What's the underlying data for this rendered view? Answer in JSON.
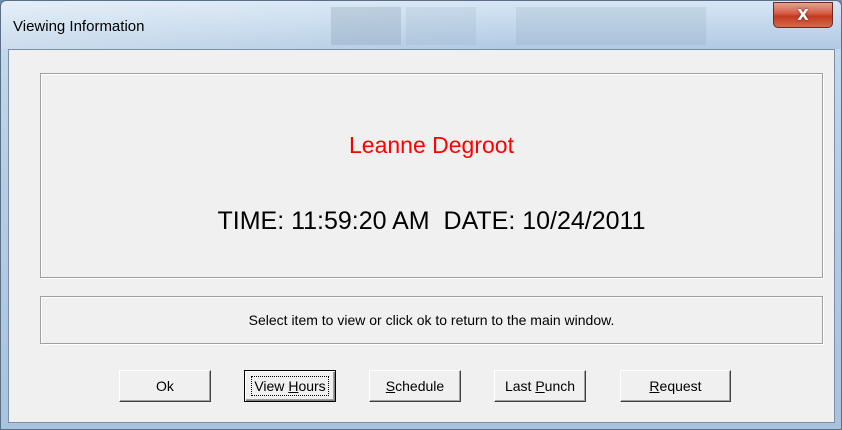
{
  "window": {
    "title": "Viewing Information",
    "close_glyph": "X"
  },
  "info": {
    "name": "Leanne Degroot",
    "name_color": "#ff0000",
    "time_date": "TIME: 11:59:20 AM  DATE: 10/24/2011"
  },
  "message": "Select item to view or click ok to return to the main window.",
  "buttons": {
    "ok": {
      "label": "Ok"
    },
    "view_hours": {
      "pre": "View ",
      "mnemonic": "H",
      "post": "ours"
    },
    "schedule": {
      "pre": "",
      "mnemonic": "S",
      "post": "chedule"
    },
    "last_punch": {
      "pre": "Last ",
      "mnemonic": "P",
      "post": "unch"
    },
    "request": {
      "pre": "",
      "mnemonic": "R",
      "post": "equest"
    }
  }
}
